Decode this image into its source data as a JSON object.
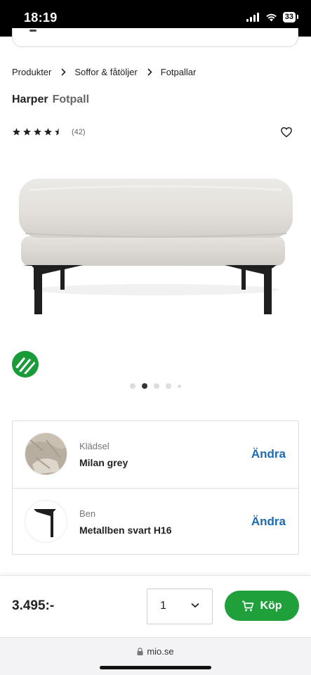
{
  "status": {
    "time": "18:19",
    "battery": "33"
  },
  "icons": {
    "signal": "cellular-signal-icon",
    "wifi": "wifi-icon",
    "battery": "battery-icon",
    "search": "search-icon",
    "chevron": "chevron-right-icon",
    "star": "star-icon",
    "heart": "heart-icon",
    "eco": "nordic-swan-ecolabel-icon",
    "cart": "cart-icon",
    "lock": "lock-icon",
    "dropdown": "chevron-down-icon"
  },
  "breadcrumb": [
    "Produkter",
    "Soffor & fåtöljer",
    "Fotpallar"
  ],
  "product": {
    "name": "Harper",
    "category": "Fotpall"
  },
  "rating": {
    "value": 4.5,
    "max": 5,
    "count": "(42)"
  },
  "gallery": {
    "slides": 5,
    "active_index": 1
  },
  "options": [
    {
      "label": "Klädsel",
      "value": "Milan grey",
      "action": "Ändra"
    },
    {
      "label": "Ben",
      "value": "Metallben svart H16",
      "action": "Ändra"
    }
  ],
  "purchase": {
    "price": "3.495:-",
    "quantity": "1",
    "buy_label": "Köp"
  },
  "browser": {
    "url": "mio.se"
  },
  "colors": {
    "buy_green": "#1fa03b",
    "link_blue": "#1b6cb2",
    "eco_green": "#1a9b3a"
  }
}
